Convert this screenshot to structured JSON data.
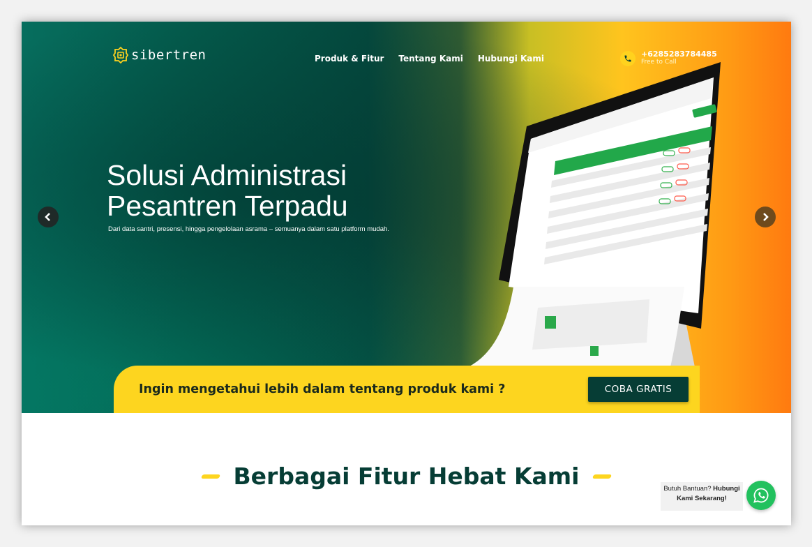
{
  "brand": {
    "name": "sibertren"
  },
  "nav": {
    "items": [
      "Produk & Fitur",
      "Tentang Kami",
      "Hubungi Kami"
    ]
  },
  "contact": {
    "phone": "+6285283784485",
    "note": "Free to Call"
  },
  "hero": {
    "title_line1": "Solusi Administrasi",
    "title_line2": "Pesantren Terpadu",
    "subtitle": "Dari data santri, presensi, hingga pengelolaan asrama – semuanya dalam satu platform mudah."
  },
  "cta": {
    "text": "Ingin mengetahui lebih dalam tentang produk kami ?",
    "button": "COBA GRATIS"
  },
  "features": {
    "title": "Berbagai Fitur Hebat Kami"
  },
  "help": {
    "line1": "Butuh Bantuan? ",
    "bold1": "Hubungi",
    "bold2": "Kami Sekarang!"
  },
  "colors": {
    "primary": "#063d35",
    "accent": "#fdd51f",
    "whatsapp": "#22c15e"
  },
  "icons": {
    "logo": "pesantren-logo-icon",
    "phone": "phone-icon",
    "prev": "chevron-left-icon",
    "next": "chevron-right-icon",
    "whatsapp": "whatsapp-icon"
  }
}
